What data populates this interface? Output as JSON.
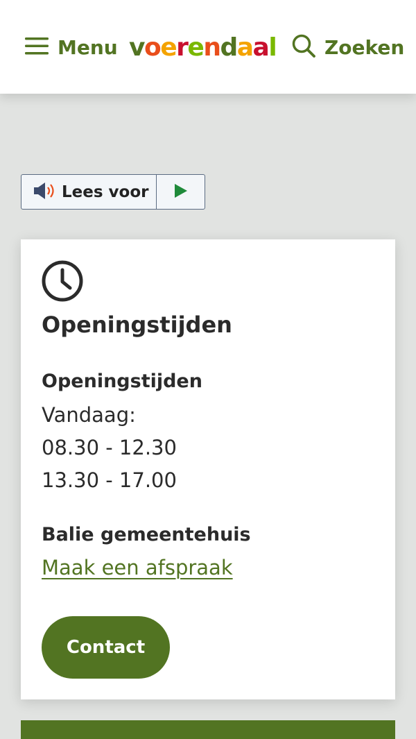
{
  "header": {
    "menu_label": "Menu",
    "menu_icon": "hamburger-icon",
    "logo_letters": [
      {
        "ch": "v",
        "color": "#527422"
      },
      {
        "ch": "o",
        "color": "#e94e1b"
      },
      {
        "ch": "e",
        "color": "#f4a300"
      },
      {
        "ch": "r",
        "color": "#c8102e"
      },
      {
        "ch": "e",
        "color": "#7ab800"
      },
      {
        "ch": "n",
        "color": "#e94e1b"
      },
      {
        "ch": "d",
        "color": "#527422"
      },
      {
        "ch": "a",
        "color": "#f4a300"
      },
      {
        "ch": "a",
        "color": "#c8102e"
      },
      {
        "ch": "l",
        "color": "#7ab800"
      }
    ],
    "search_label": "Zoeken",
    "search_icon": "search-icon"
  },
  "readspeaker": {
    "label": "Lees voor",
    "speaker_icon": "speaker-icon",
    "play_icon": "play-icon"
  },
  "card": {
    "icon": "clock-icon",
    "title": "Openingstijden",
    "hours_heading": "Openingstijden",
    "today_label": "Vandaag:",
    "slots": [
      "08.30 - 12.30",
      "13.30 - 17.00"
    ],
    "desk_heading": "Balie gemeentehuis",
    "appointment_link": "Maak een afspraak",
    "contact_button": "Contact"
  },
  "colors": {
    "brand_green": "#527422",
    "page_background": "#e1e3e1",
    "text": "#2b2b2b"
  }
}
